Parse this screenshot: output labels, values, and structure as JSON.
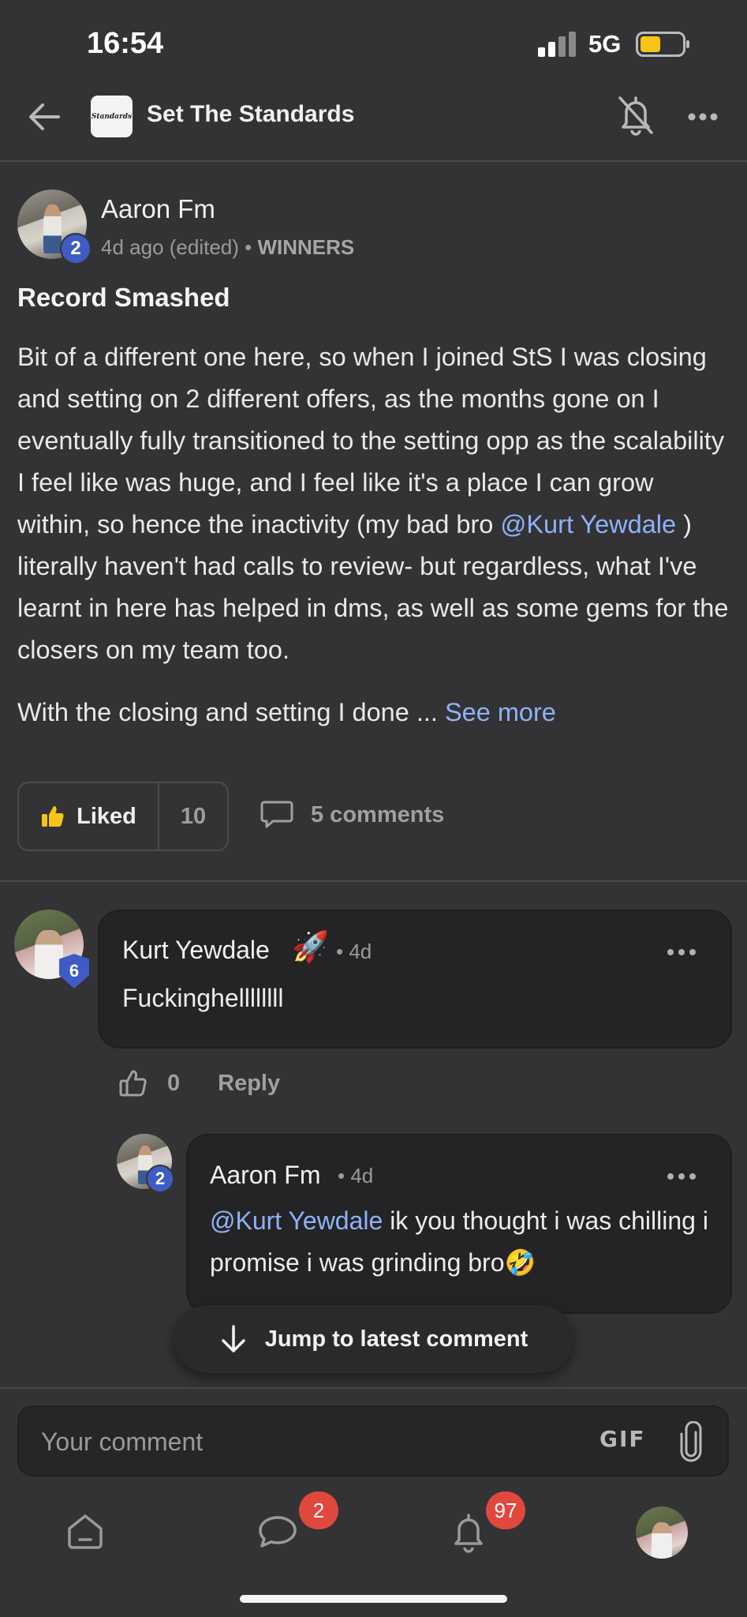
{
  "status_bar": {
    "time": "16:54",
    "network": "5G"
  },
  "header": {
    "group_name": "Set The Standards",
    "logo_text": "Standards"
  },
  "post": {
    "author": "Aaron Fm",
    "level": "2",
    "time": "4d ago (edited)",
    "separator": "•",
    "category": "WINNERS",
    "title": "Record Smashed",
    "body_before_mention": "Bit of a different one here, so when I joined StS I was closing and setting on 2 different offers, as the months gone on I eventually fully transitioned to the setting opp as the scalability I feel like was huge, and I feel like it's a place I can grow within, so hence the inactivity (my bad bro ",
    "mention": "@Kurt Yewdale",
    "body_after_mention": " ) literally haven't had calls to review- but regardless, what I've learnt in here has helped in dms, as well as some gems for the closers on my team too.",
    "body_second": "With the closing and setting I done ... ",
    "see_more": "See more",
    "like_label": "Liked",
    "like_count": "10",
    "comments_label": "5 comments"
  },
  "comments": [
    {
      "author": "Kurt Yewdale",
      "emoji": "🚀",
      "time": "• 4d",
      "level": "6",
      "text": "Fuckinghellllllll",
      "like_count": "0",
      "reply_label": "Reply"
    },
    {
      "author": "Aaron Fm",
      "time": "• 4d",
      "level": "2",
      "mention": "@Kurt Yewdale",
      "text": " ik you thought i was chilling i promise i was grinding bro",
      "emoji": "🤣"
    }
  ],
  "jump_button": "Jump to latest comment",
  "composer": {
    "placeholder": "Your comment",
    "gif_label": "GIF"
  },
  "bottom_nav": {
    "chat_badge": "2",
    "notifications_badge": "97"
  },
  "colors": {
    "background": "#333335",
    "bubble": "#242426",
    "mention": "#8fb2f7",
    "badge_blue": "#3f5bc4",
    "notification_red": "#e0483e",
    "battery_yellow": "#f5c518"
  },
  "icons": [
    "back-arrow-icon",
    "bell-off-icon",
    "more-horizontal-icon",
    "thumbs-up-icon",
    "comment-icon",
    "arrow-down-icon",
    "paperclip-icon",
    "home-icon",
    "chat-icon",
    "bell-icon"
  ]
}
